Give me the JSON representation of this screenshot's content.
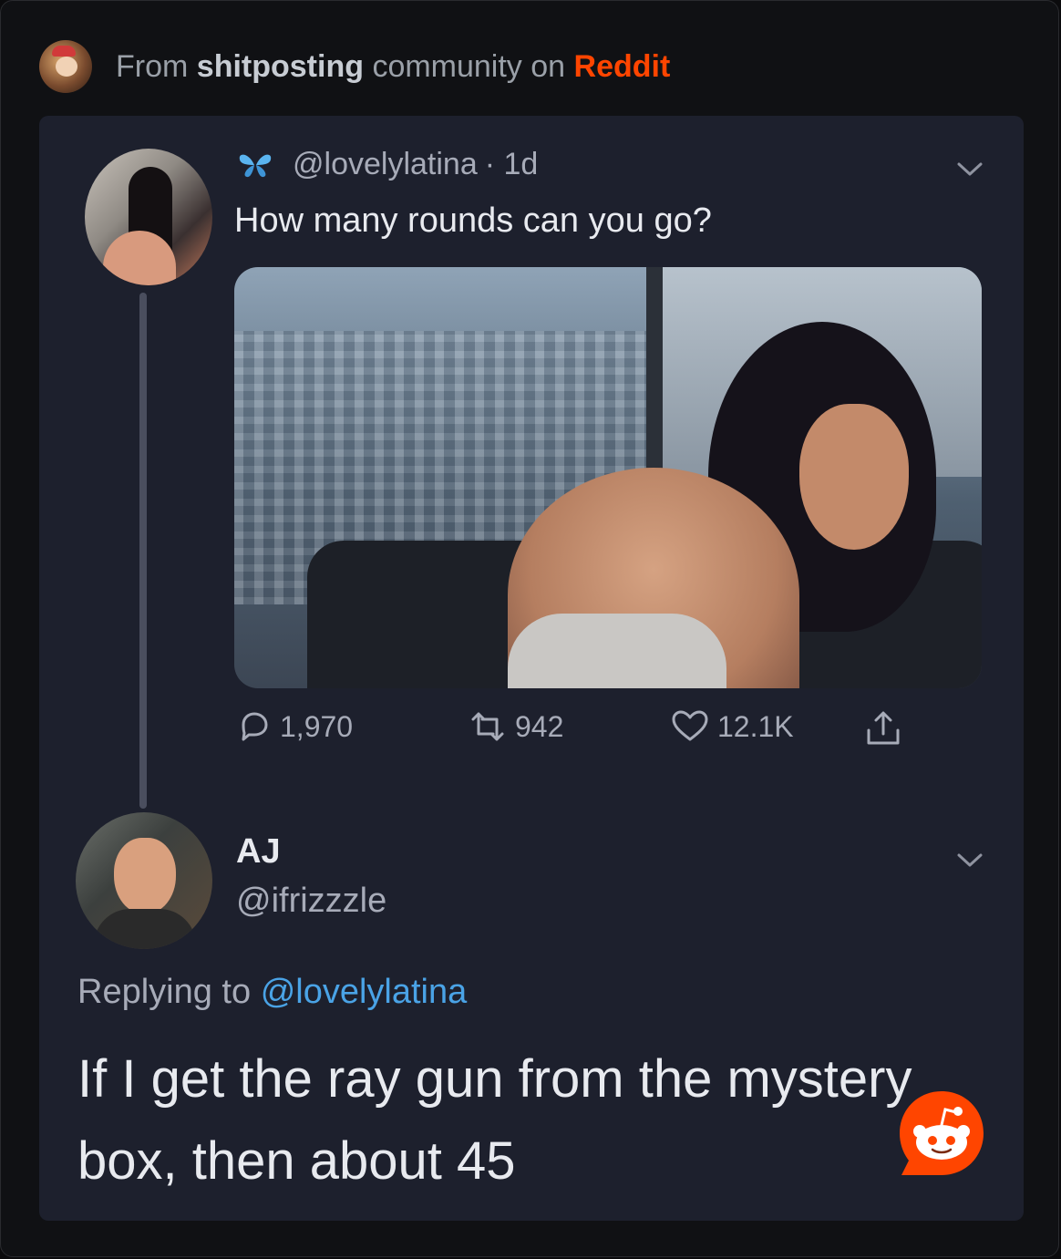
{
  "source": {
    "prefix": "From",
    "community": "shitposting",
    "middle": "community on",
    "platform": "Reddit"
  },
  "tweet": {
    "handle": "@lovelylatina",
    "time": "· 1d",
    "text": "How many rounds can you go?",
    "replies": "1,970",
    "retweets": "942",
    "likes": "12.1K"
  },
  "reply": {
    "name": "AJ",
    "handle": "@ifrizzzle",
    "replying_prefix": "Replying to",
    "replying_to": "@lovelylatina",
    "text": "If I get the ray gun from the mystery box, then about 45"
  },
  "icons": {
    "avatar": "avatar",
    "butterfly": "butterfly-icon",
    "chevron": "chevron-down-icon",
    "reply": "reply-icon",
    "retweet": "retweet-icon",
    "like": "heart-icon",
    "share": "share-icon",
    "reddit": "reddit-snoo-icon"
  },
  "colors": {
    "reddit": "#ff4500",
    "mention": "#4aa3e6",
    "butterfly": "#5ab4f0",
    "card": "#1d202d"
  }
}
